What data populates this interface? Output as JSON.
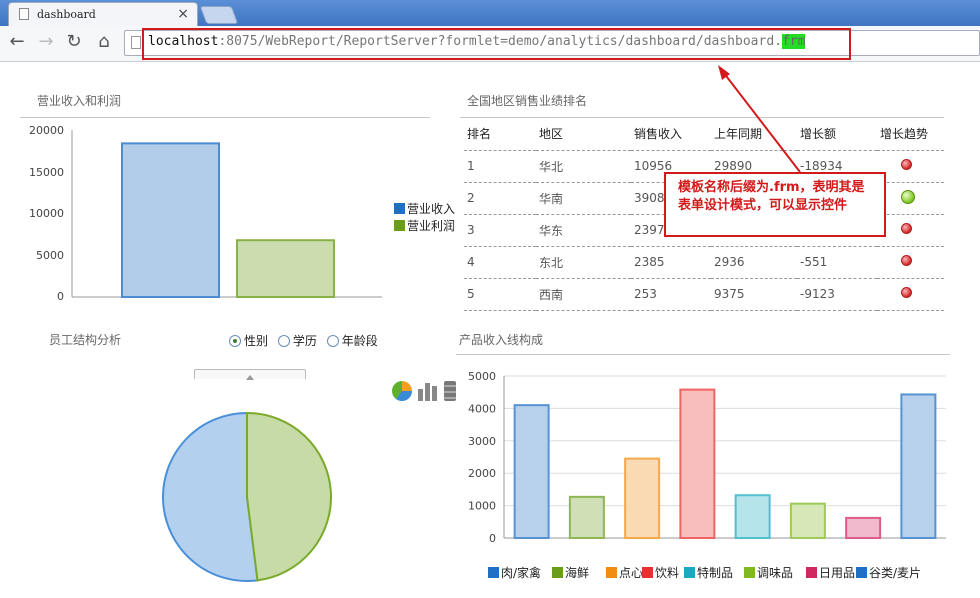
{
  "browser": {
    "tab_title": "dashboard",
    "tab_close": "×",
    "url_host": "localhost",
    "url_path": ":8075/WebReport/ReportServer?formlet=demo/analytics/dashboard/dashboard.",
    "url_ext": "frm"
  },
  "revenue_panel": {
    "title": "营业收入和利润"
  },
  "ranking_panel": {
    "title": "全国地区销售业绩排名",
    "columns": [
      "排名",
      "地区",
      "销售收入",
      "上年同期",
      "增长额",
      "增长趋势"
    ],
    "rows": [
      [
        "1",
        "华北",
        "10956",
        "29890",
        "-18934",
        "down"
      ],
      [
        "2",
        "华南",
        "3908",
        "",
        "",
        "up"
      ],
      [
        "3",
        "华东",
        "2397",
        "",
        "",
        "down"
      ],
      [
        "4",
        "东北",
        "2385",
        "2936",
        "-551",
        "down"
      ],
      [
        "5",
        "西南",
        "253",
        "9375",
        "-9123",
        "down"
      ]
    ]
  },
  "annotation": {
    "text": "模板名称后缀为.frm，表明其是表单设计模式，可以显示控件"
  },
  "staff_panel": {
    "title": "员工结构分析",
    "options": [
      "性别",
      "学历",
      "年龄段"
    ],
    "selected": "性别"
  },
  "product_panel": {
    "title": "产品收入线构成"
  },
  "colors": {
    "accent_red": "#d21a1a",
    "blue": "#4a90d9",
    "green": "#7aaa2a"
  },
  "chart_data": [
    {
      "type": "bar",
      "categories": [
        ""
      ],
      "series": [
        {
          "name": "营业收入",
          "values": [
            18400
          ],
          "color": "#1f6fc4"
        },
        {
          "name": "营业利润",
          "values": [
            6800
          ],
          "color": "#6a9e1a"
        }
      ],
      "ylim": [
        0,
        20000
      ],
      "yticks": [
        "20000",
        "15000",
        "10000",
        "5000",
        "0"
      ],
      "legend": "right"
    },
    {
      "type": "pie",
      "slices": [
        {
          "value": 52,
          "color": "#4a90d9"
        },
        {
          "value": 48,
          "color": "#7aaa2a"
        }
      ]
    },
    {
      "type": "bar",
      "categories": [
        "肉/家禽",
        "海鲜",
        "点心",
        "饮料",
        "特制品",
        "调味品",
        "日用品",
        "谷类/麦片"
      ],
      "values": [
        4100,
        1270,
        2450,
        4580,
        1320,
        1060,
        620,
        4430
      ],
      "colors": [
        "#1f6fc4",
        "#6a9e1a",
        "#f08c10",
        "#e83030",
        "#18aac0",
        "#80b820",
        "#d02860",
        "#1f6fc4"
      ],
      "ylim": [
        0,
        5000
      ],
      "yticks": [
        "5000",
        "4000",
        "3000",
        "2000",
        "1000",
        "0"
      ],
      "grid": true,
      "legend": "bottom"
    }
  ]
}
